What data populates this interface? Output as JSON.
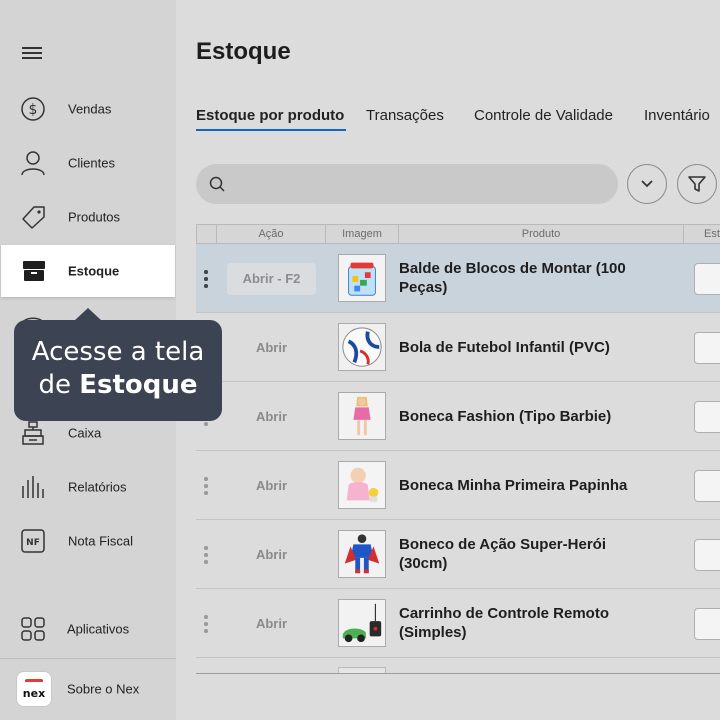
{
  "sidebar": {
    "items": [
      {
        "label": "Vendas",
        "icon": "dollar-icon"
      },
      {
        "label": "Clientes",
        "icon": "user-icon"
      },
      {
        "label": "Produtos",
        "icon": "tag-icon"
      },
      {
        "label": "Estoque",
        "icon": "box-icon"
      },
      {
        "label": "Caixa",
        "icon": "cash-register-icon"
      },
      {
        "label": "Relatórios",
        "icon": "bar-chart-icon"
      },
      {
        "label": "Nota Fiscal",
        "icon": "nf-icon"
      },
      {
        "label": "Aplicativos",
        "icon": "apps-grid-icon"
      }
    ],
    "active": "Estoque",
    "about": {
      "label": "Sobre o Nex",
      "logo_text": "nex"
    },
    "nf_icon_text": "NF"
  },
  "page": {
    "title": "Estoque",
    "tabs": [
      "Estoque por produto",
      "Transações",
      "Controle de Validade",
      "Inventário"
    ],
    "active_tab": "Estoque por produto",
    "search": {
      "value": "",
      "placeholder": ""
    }
  },
  "table": {
    "columns": [
      "Ação",
      "Imagem",
      "Produto",
      "Est"
    ],
    "rows": [
      {
        "action": "Abrir - F2",
        "product": "Balde de Blocos de Montar (100 Peças)",
        "selected": true
      },
      {
        "action": "Abrir",
        "product": "Bola de Futebol Infantil (PVC)",
        "selected": false
      },
      {
        "action": "Abrir",
        "product": "Boneca Fashion (Tipo Barbie)",
        "selected": false
      },
      {
        "action": "Abrir",
        "product": "Boneca Minha Primeira Papinha",
        "selected": false
      },
      {
        "action": "Abrir",
        "product": "Boneco de Ação Super-Herói (30cm)",
        "selected": false
      },
      {
        "action": "Abrir",
        "product": "Carrinho de Controle Remoto (Simples)",
        "selected": false
      }
    ]
  },
  "tooltip": {
    "line1": "Acesse a tela",
    "line2_prefix": "de ",
    "line2_bold": "Estoque"
  },
  "colors": {
    "accent": "#1565c0",
    "tooltip_bg": "#3c4453",
    "nex_red": "#e53935",
    "selected_row": "#c8d3dc"
  }
}
